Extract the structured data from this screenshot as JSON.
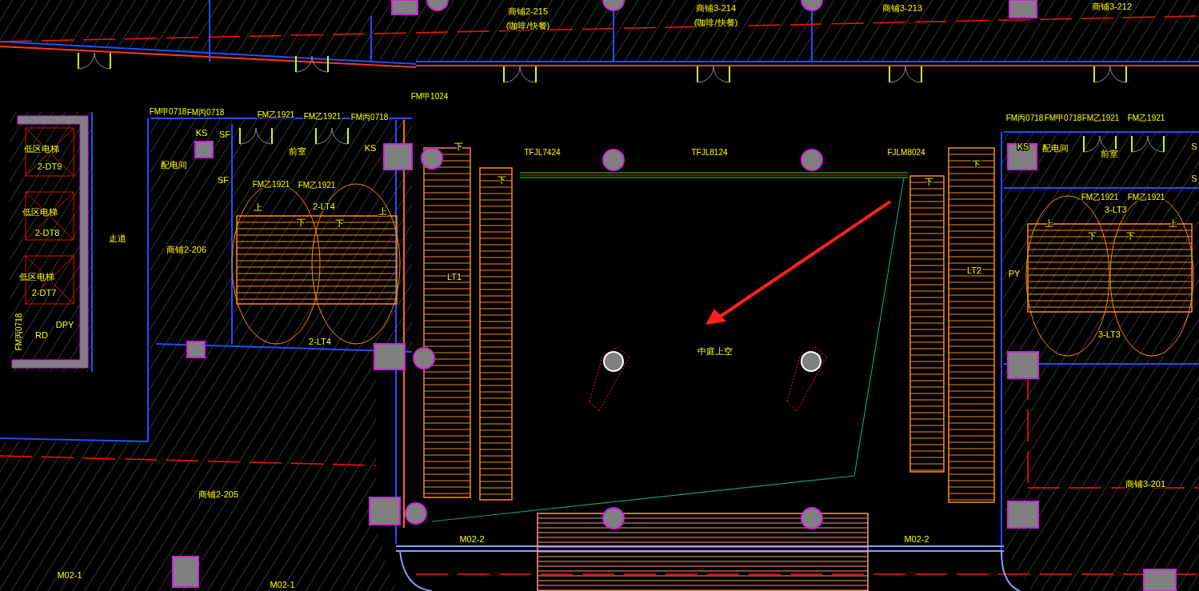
{
  "plan": {
    "labels": [
      {
        "text": "商铺2-215"
      },
      {
        "text": "商铺3-214"
      },
      {
        "text": "商铺3-213"
      },
      {
        "text": "商铺3-212"
      },
      {
        "text": "(咖啡/快餐)"
      },
      {
        "text": "(咖啡/快餐)"
      },
      {
        "text": "FM甲1024"
      },
      {
        "text": "FM甲0718"
      },
      {
        "text": "FM丙0718"
      },
      {
        "text": "FM乙1921"
      },
      {
        "text": "FM乙1921"
      },
      {
        "text": "FM丙0718"
      },
      {
        "text": "FM丙0718"
      },
      {
        "text": "FM甲0718"
      },
      {
        "text": "FM乙1921"
      },
      {
        "text": "FM乙1921"
      },
      {
        "text": "KS"
      },
      {
        "text": "SF"
      },
      {
        "text": "低区电梯"
      },
      {
        "text": "前室"
      },
      {
        "text": "KS"
      },
      {
        "text": "下"
      },
      {
        "text": "TFJL7424"
      },
      {
        "text": "TFJL8124"
      },
      {
        "text": "FJLM8024"
      },
      {
        "text": "KS"
      },
      {
        "text": "配电间"
      },
      {
        "text": "前室"
      },
      {
        "text": "S"
      },
      {
        "text": "2-DT9"
      },
      {
        "text": "配电间"
      },
      {
        "text": "下"
      },
      {
        "text": "SF"
      },
      {
        "text": "FM乙1921"
      },
      {
        "text": "FM乙1921"
      },
      {
        "text": "下"
      },
      {
        "text": "下"
      },
      {
        "text": "S"
      },
      {
        "text": "FM乙1921"
      },
      {
        "text": "FM乙1921"
      },
      {
        "text": "低区电梯"
      },
      {
        "text": "上"
      },
      {
        "text": "2-LT4"
      },
      {
        "text": "上"
      },
      {
        "text": "3-LT3"
      },
      {
        "text": "下"
      },
      {
        "text": "下"
      },
      {
        "text": "上"
      },
      {
        "text": "上"
      },
      {
        "text": "2-DT8"
      },
      {
        "text": "走道"
      },
      {
        "text": "下"
      },
      {
        "text": "下"
      },
      {
        "text": "商铺2-206"
      },
      {
        "text": "低区电梯"
      },
      {
        "text": "LT1"
      },
      {
        "text": "LT2"
      },
      {
        "text": "PY"
      },
      {
        "text": "2-DT7"
      },
      {
        "text": "FM丙0718"
      },
      {
        "text": "DPY"
      },
      {
        "text": "RD"
      },
      {
        "text": "2-LT4"
      },
      {
        "text": "3-LT3"
      },
      {
        "text": "中庭上空"
      },
      {
        "text": "商铺3-201"
      },
      {
        "text": "商铺2-205"
      },
      {
        "text": "M02-2"
      },
      {
        "text": "M02-2"
      },
      {
        "text": "M02-1"
      },
      {
        "text": "M02-1"
      }
    ]
  }
}
